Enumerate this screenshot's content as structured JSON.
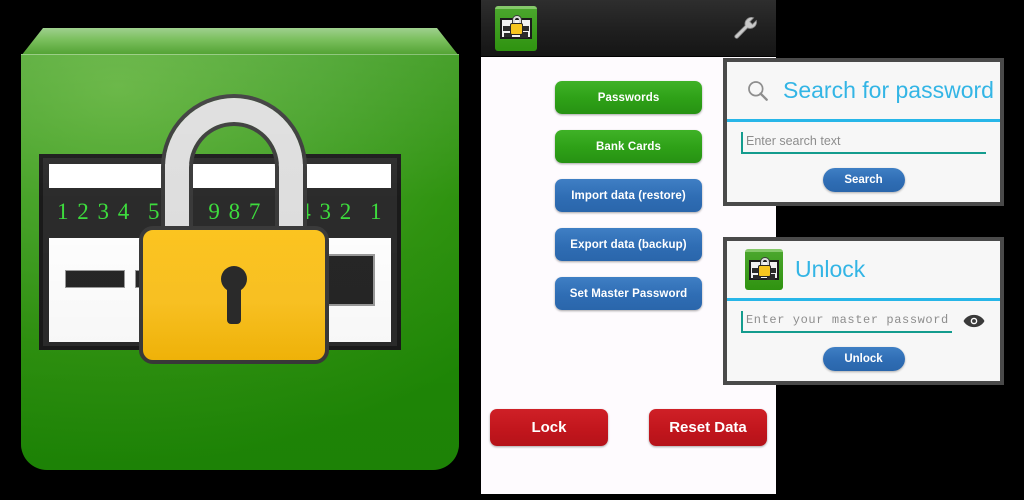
{
  "app_icon": {
    "name": "password-manager-app-icon",
    "background_color": "#2f9310",
    "card_numbers": [
      "1 2 3 4",
      "5",
      "8",
      "9 8 7",
      "5 4 3 2",
      "1"
    ],
    "lock_color": "#fdc423",
    "shackle_color": "#dedede"
  },
  "phone": {
    "actionbar": {
      "app_icon_name": "app-logo-icon",
      "settings_icon_name": "wrench-icon"
    },
    "buttons": [
      {
        "label": "Passwords",
        "style": "green"
      },
      {
        "label": "Bank Cards",
        "style": "green"
      },
      {
        "label": "Import data (restore)",
        "style": "blue"
      },
      {
        "label": "Export data (backup)",
        "style": "blue"
      },
      {
        "label": "Set Master Password",
        "style": "blue"
      }
    ],
    "bottom_buttons": [
      {
        "label": "Lock",
        "style": "red"
      },
      {
        "label": "Reset Data",
        "style": "red"
      }
    ]
  },
  "search_dialog": {
    "title": "Search for password",
    "icon_name": "magnifier-icon",
    "input_placeholder": "Enter search text",
    "input_value": "",
    "button_label": "Search",
    "accent_color": "#33b5e5",
    "field_underline_color": "#149c8e"
  },
  "unlock_dialog": {
    "title": "Unlock",
    "icon_name": "app-logo-icon",
    "input_placeholder": "Enter your master password",
    "input_value": "",
    "button_label": "Unlock",
    "reveal_icon_name": "eye-icon",
    "accent_color": "#33b5e5",
    "field_underline_color": "#149c8e"
  }
}
